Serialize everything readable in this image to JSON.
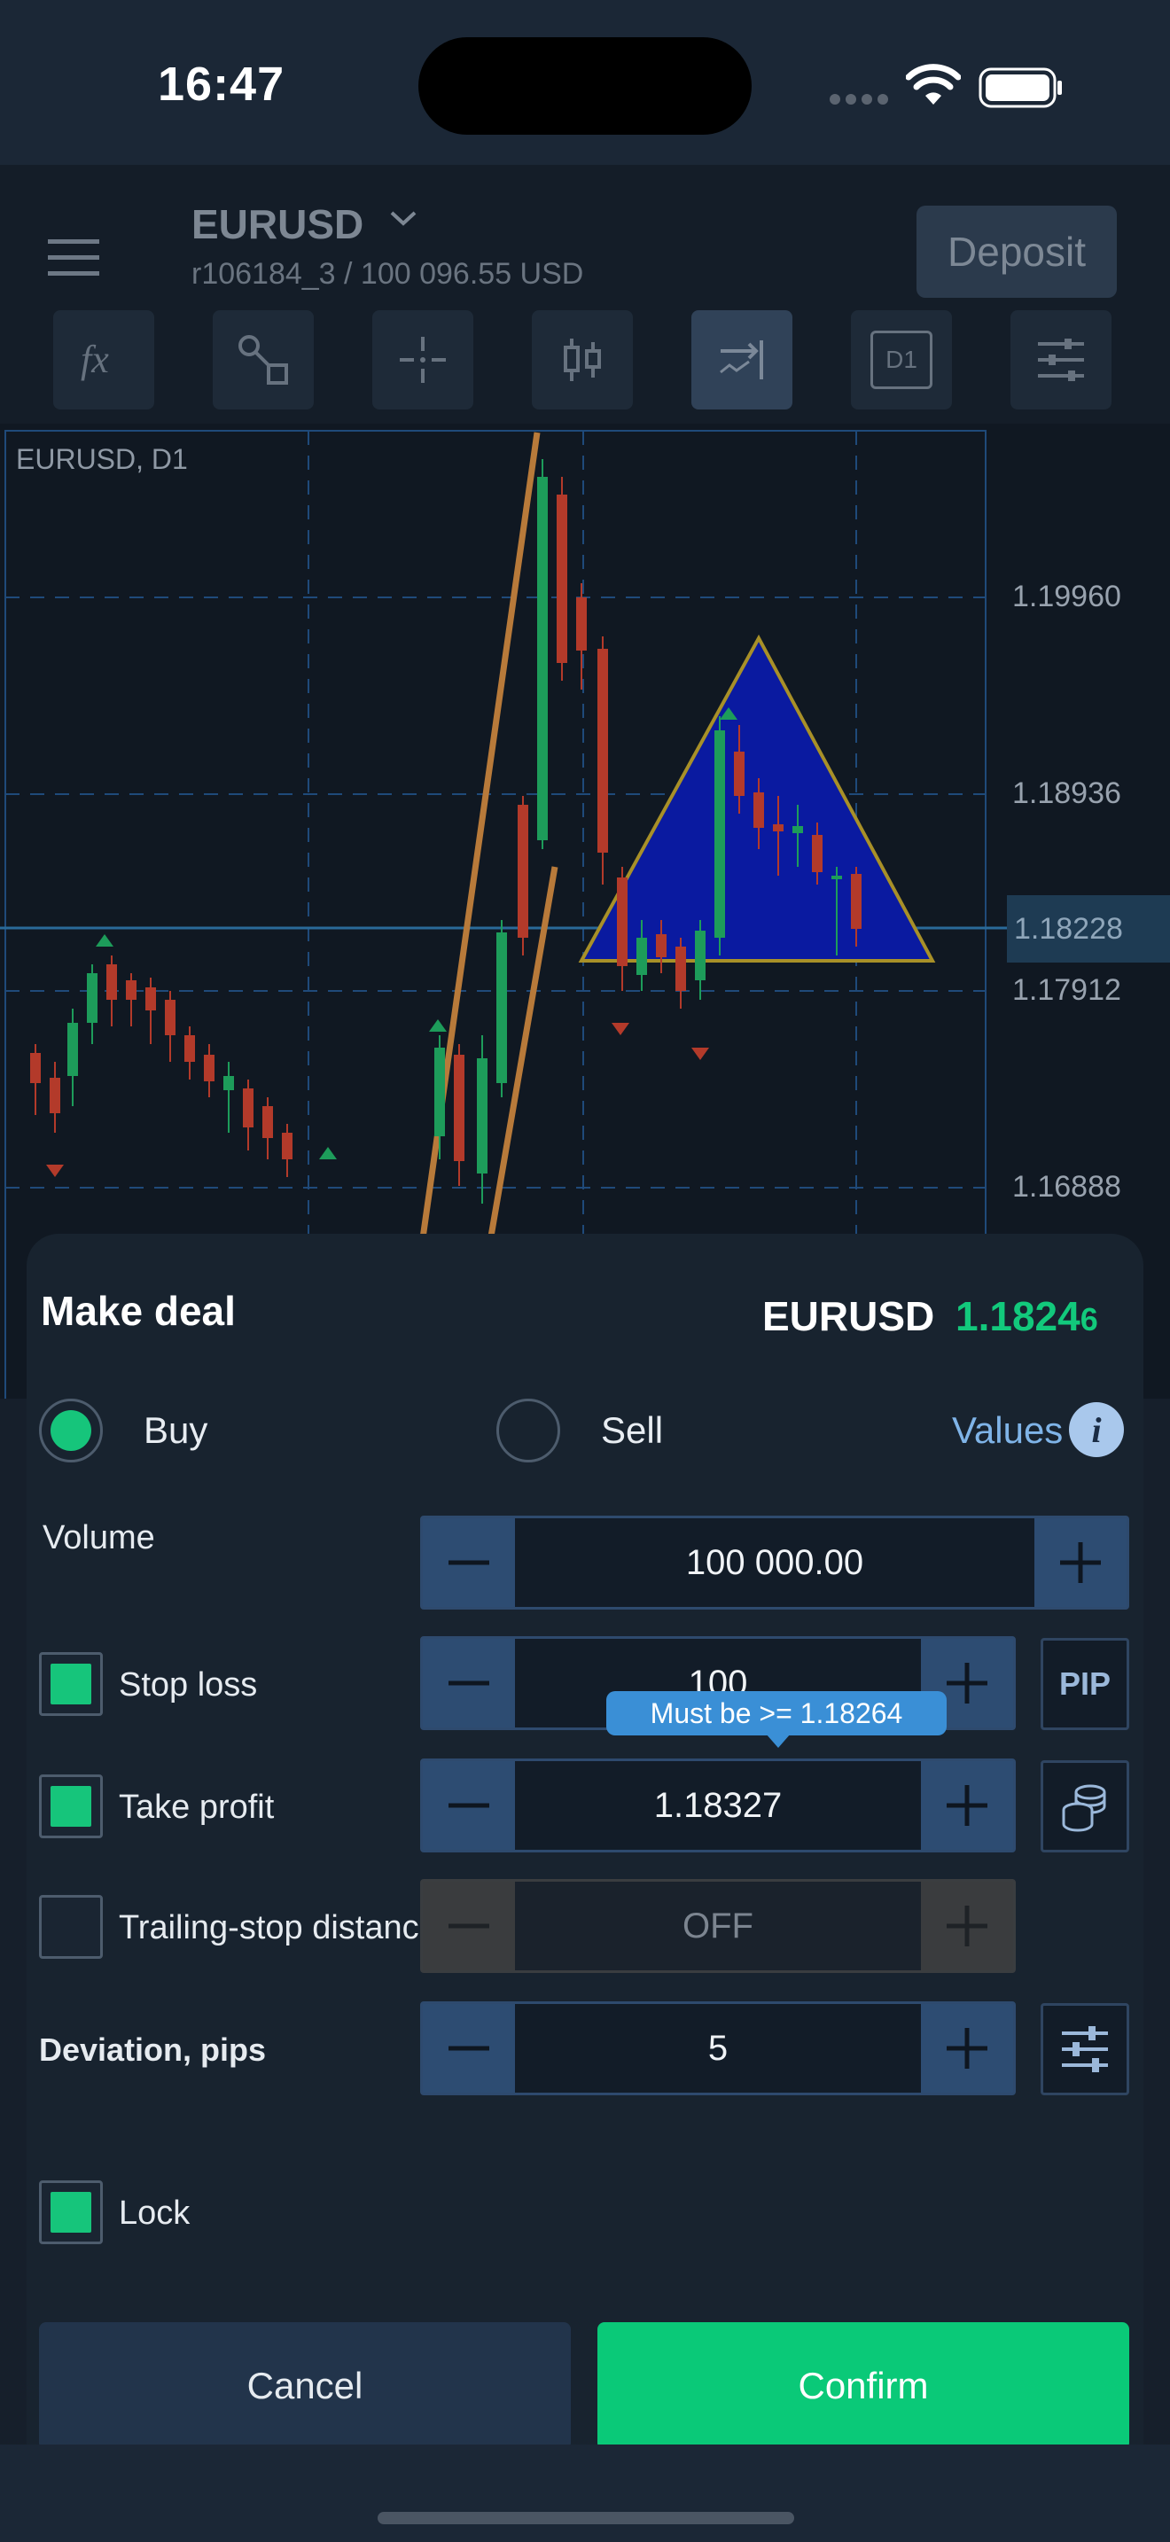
{
  "status_bar": {
    "time": "16:47"
  },
  "header": {
    "symbol": "EURUSD",
    "account_info": "r106184_3 / 100 096.55 USD",
    "deposit_label": "Deposit"
  },
  "toolbar": {
    "items": [
      {
        "name": "indicators",
        "icon": "fx-icon"
      },
      {
        "name": "objects",
        "icon": "shapes-icon"
      },
      {
        "name": "crosshair",
        "icon": "crosshair-icon"
      },
      {
        "name": "chart-type",
        "icon": "candlestick-icon"
      },
      {
        "name": "autoscroll",
        "icon": "autoscroll-icon",
        "active": true
      },
      {
        "name": "timeframe",
        "label": "D1"
      },
      {
        "name": "settings",
        "icon": "sliders-icon"
      }
    ]
  },
  "chart": {
    "label": "EURUSD, D1",
    "price_levels": [
      "1.19960",
      "1.18936",
      "1.17912",
      "1.16888"
    ],
    "current_price": "1.18228"
  },
  "deal": {
    "title": "Make deal",
    "symbol": "EURUSD",
    "price_main": "1.1824",
    "price_small": "6",
    "buy_label": "Buy",
    "sell_label": "Sell",
    "side_selected": "buy",
    "values_label": "Values",
    "volume": {
      "label": "Volume",
      "value": "100 000.00"
    },
    "stop_loss": {
      "label": "Stop loss",
      "value": "100",
      "checked": true,
      "unit_button": "PIP"
    },
    "tooltip": "Must be >= 1.18264",
    "take_profit": {
      "label": "Take profit",
      "value": "1.18327",
      "checked": true
    },
    "trailing_stop": {
      "label": "Trailing-stop distance",
      "value": "OFF",
      "checked": false
    },
    "deviation": {
      "label": "Deviation, pips",
      "value": "5"
    },
    "lock": {
      "label": "Lock",
      "checked": true
    },
    "cancel_label": "Cancel",
    "confirm_label": "Confirm"
  },
  "colors": {
    "buy_green": "#0ac978",
    "bull_candle": "#1d9c5a",
    "bear_candle": "#b33a2a",
    "triangle_fill": "#0a1aa0",
    "accent_blue": "#3a8fd6"
  }
}
